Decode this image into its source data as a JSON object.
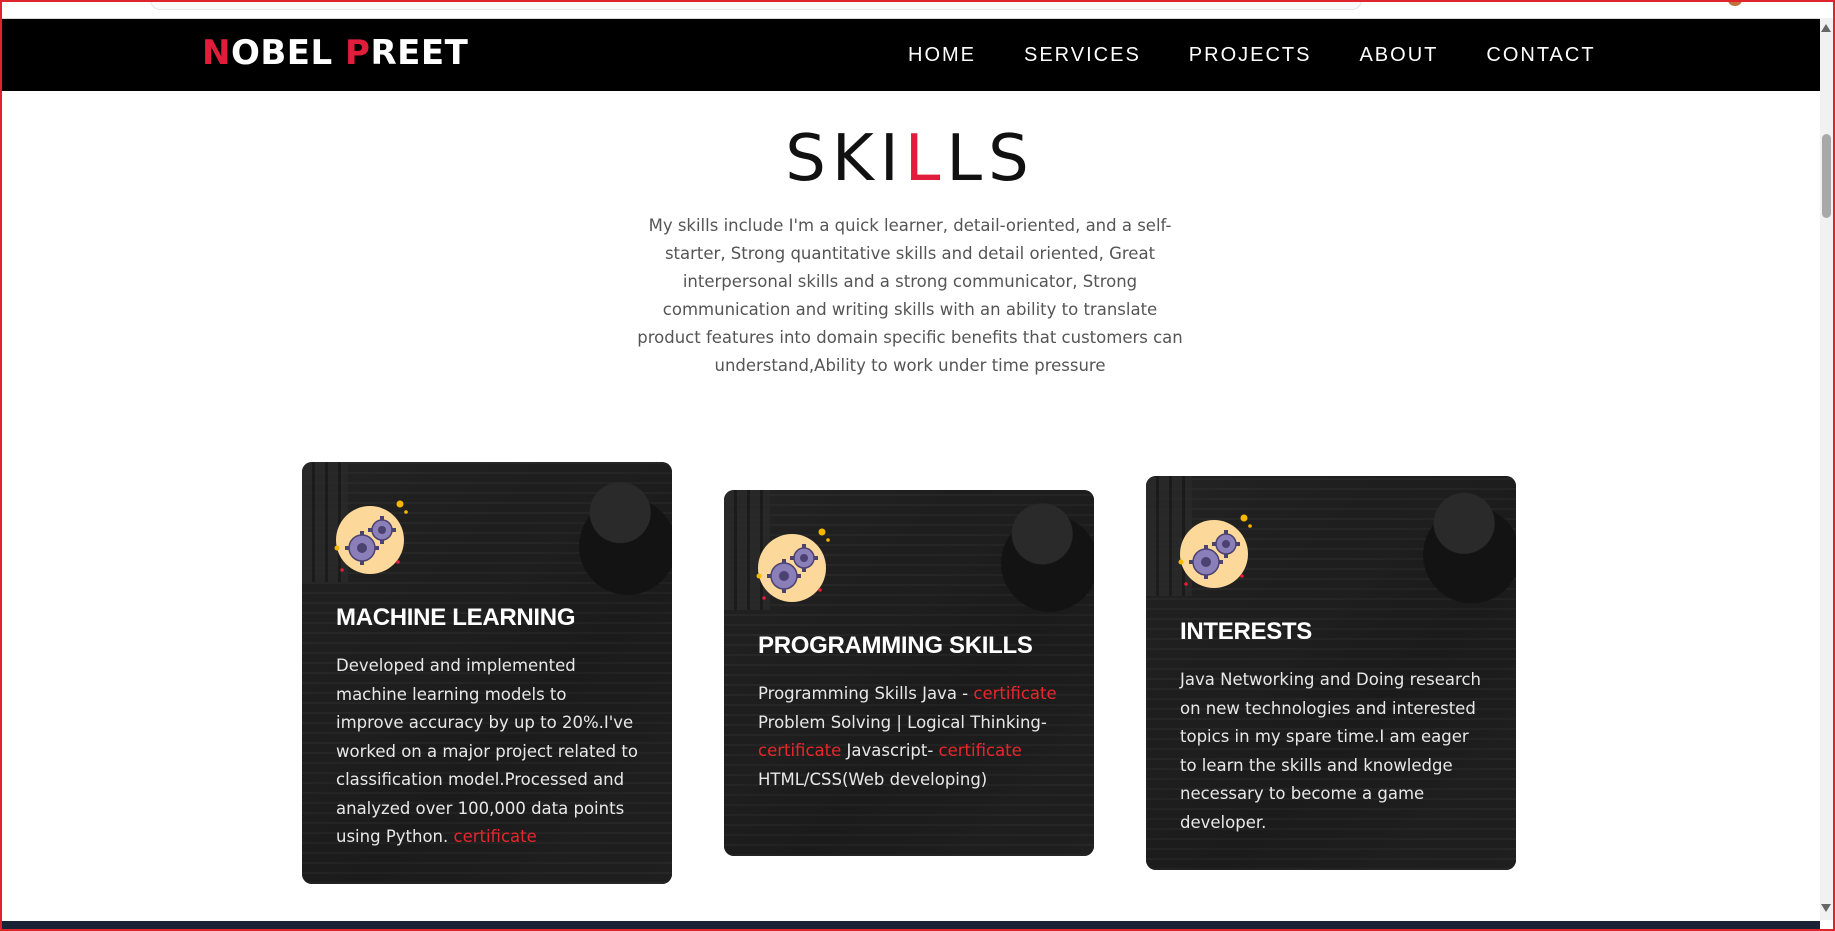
{
  "brand": {
    "part1_initial": "N",
    "part1_rest": "OBEL ",
    "part2_initial": "P",
    "part2_rest": "REET"
  },
  "nav": [
    "HOME",
    "SERVICES",
    "PROJECTS",
    "ABOUT",
    "CONTACT"
  ],
  "skills": {
    "title_start": "SKI",
    "title_accent": "L",
    "title_end": "LS",
    "intro": "My skills include I'm a quick learner, detail-oriented, and a self-starter, Strong quantitative skills and detail oriented, Great interpersonal skills and a strong communicator, Strong communication and writing skills with an ability to translate product features into domain specific benefits that customers can understand,Ability to work under time pressure"
  },
  "cards": [
    {
      "title": "MACHINE LEARNING",
      "text": "Developed and implemented machine learning models to improve accuracy by up to 20%.I've worked on a major project related to classification model.Processed and analyzed over 100,000 data points using Python. ",
      "link": "certificate"
    },
    {
      "title": "PROGRAMMING SKILLS",
      "seg1": "Programming Skills Java - ",
      "link1": "certificate",
      "seg2": " Problem Solving | Logical Thinking- ",
      "link2": "certificate",
      "seg3": " Javascript- ",
      "link3": "certificate",
      "seg4": " HTML/CSS(Web developing)"
    },
    {
      "title": "INTERESTS",
      "text": "Java Networking and Doing research on new technologies and interested topics in my spare time.I am eager to learn the skills and knowledge necessary to become a game developer."
    }
  ],
  "colors": {
    "accent": "#e11d3b",
    "navbar": "#000000",
    "card": "#1e1e1e",
    "link": "#e8262c"
  },
  "icons": {
    "card_icon": "gears-icon"
  }
}
